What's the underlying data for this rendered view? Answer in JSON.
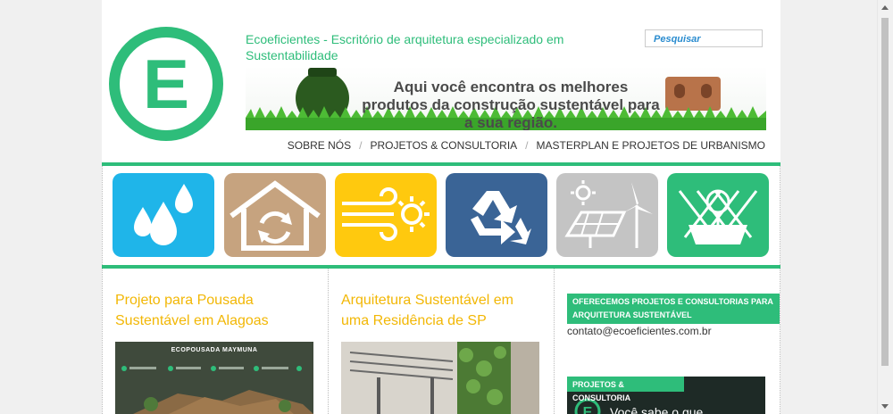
{
  "header": {
    "logo_letter": "E",
    "site_title": "Ecoeficientes - Escritório de arquitetura especializado em Sustentabilidade",
    "search_placeholder": "Pesquisar",
    "banner_text": "Aqui você encontra os melhores produtos da construção sustentável para a sua região."
  },
  "nav": {
    "items": [
      {
        "label": "SOBRE NÓS"
      },
      {
        "label": "PROJETOS & CONSULTORIA"
      },
      {
        "label": "MASTERPLAN E PROJETOS DE URBANISMO"
      }
    ],
    "separator": "/"
  },
  "categories": [
    {
      "icon": "water-drops-icon",
      "color": "#1fb5e9"
    },
    {
      "icon": "house-recycle-icon",
      "color": "#c6a37f"
    },
    {
      "icon": "wind-sun-icon",
      "color": "#ffc90e"
    },
    {
      "icon": "recycle-icon",
      "color": "#3a6496"
    },
    {
      "icon": "solar-wind-icon",
      "color": "#c4c4c4"
    },
    {
      "icon": "green-roof-icon",
      "color": "#2ebd7a"
    }
  ],
  "posts": [
    {
      "title": "Projeto para Pousada Sustentável em Alagoas",
      "image_caption": "ECOPOUSADA MAYMUNA"
    },
    {
      "title": "Arquitetura Sustentável em uma Residência de SP"
    }
  ],
  "sidebar": {
    "widget1_title": "OFERECEMOS PROJETOS E CONSULTORIAS PARA ARQUITETURA SUSTENTÁVEL",
    "contact_email": "contato@ecoeficientes.com.br",
    "widget2_title": "PROJETOS & CONSULTORIA",
    "video_text": "Você sabe o que"
  },
  "colors": {
    "brand_green": "#2ebd7a",
    "post_title_yellow": "#f2b705"
  }
}
